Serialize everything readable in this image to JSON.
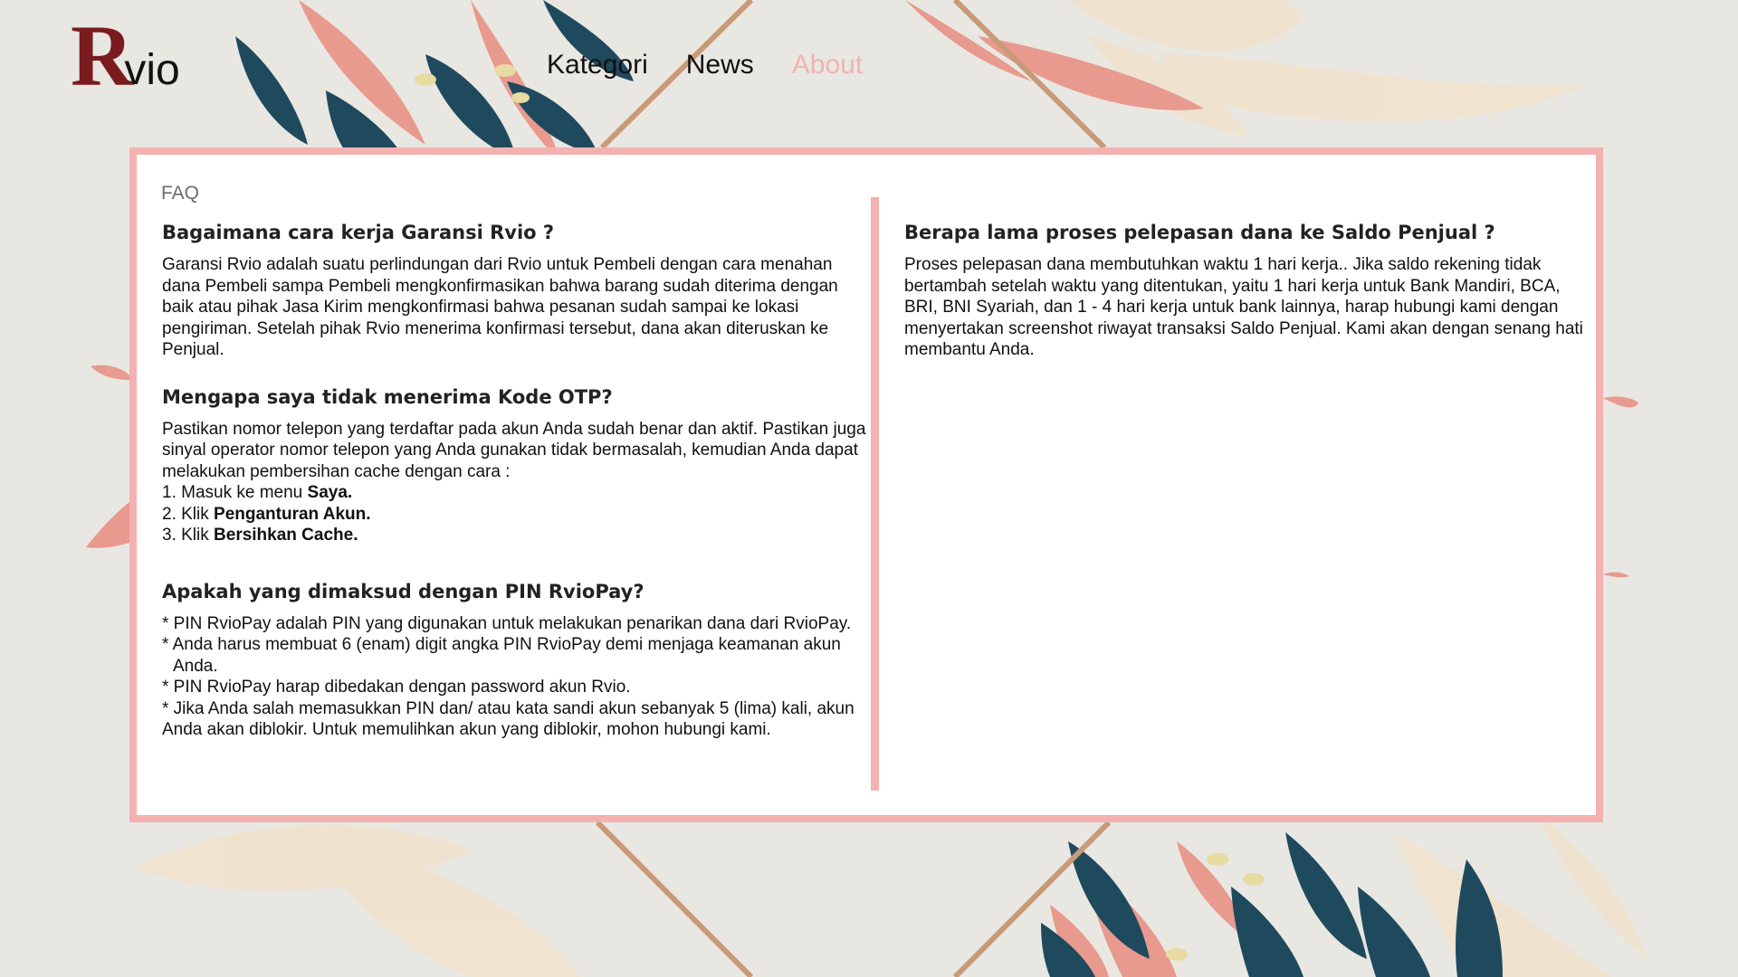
{
  "header": {
    "logo": {
      "first": "R",
      "rest": "vio"
    },
    "nav": [
      {
        "label": "Kategori",
        "active": false
      },
      {
        "label": "News",
        "active": false
      },
      {
        "label": "About",
        "active": true
      }
    ]
  },
  "colors": {
    "accent_pink": "#f3b1b0",
    "logo_red": "#7a1c1f",
    "nav_active": "#f0b4b2",
    "leaf_teal": "#1f4a5e",
    "leaf_pink": "#e89a8f"
  },
  "faq": {
    "label": "FAQ",
    "left": [
      {
        "question": "Bagaimana cara kerja Garansi Rvio ?",
        "answer": "Garansi Rvio adalah suatu perlindungan dari Rvio untuk Pembeli dengan cara menahan dana Pembeli sampa Pembeli mengkonfirmasikan bahwa barang sudah diterima dengan baik atau pihak Jasa Kirim mengkonfirmasi bahwa pesanan sudah sampai ke lokasi pengiriman. Setelah pihak Rvio menerima konfirmasi tersebut, dana akan diteruskan ke Penjual."
      },
      {
        "question": "Mengapa saya tidak menerima Kode OTP?",
        "intro": "Pastikan nomor telepon yang terdaftar pada akun Anda sudah benar dan aktif. Pastikan juga sinyal operator nomor telepon yang Anda gunakan tidak bermasalah, kemudian Anda dapat melakukan pembersihan cache dengan cara :",
        "steps": [
          {
            "prefix": "1. Masuk ke menu ",
            "bold": "Saya."
          },
          {
            "prefix": "2. Klik ",
            "bold": "Penganturan Akun."
          },
          {
            "prefix": "3. Klik ",
            "bold": "Bersihkan Cache."
          }
        ]
      },
      {
        "question": "Apakah yang dimaksud dengan PIN RvioPay?",
        "bullets": [
          "* PIN RvioPay adalah PIN yang digunakan untuk melakukan penarikan dana dari RvioPay.",
          "* Anda harus membuat 6 (enam) digit angka PIN RvioPay demi menjaga keamanan akun Anda.",
          "* PIN RvioPay harap dibedakan dengan password akun Rvio.",
          "* Jika Anda salah memasukkan PIN dan/ atau kata sandi akun sebanyak 5 (lima) kali, akun Anda akan diblokir. Untuk memulihkan akun yang diblokir, mohon hubungi kami."
        ]
      }
    ],
    "right": [
      {
        "question": "Berapa lama proses pelepasan dana ke Saldo Penjual ?",
        "answer": "Proses pelepasan dana membutuhkan waktu 1 hari kerja.. Jika saldo rekening tidak bertambah setelah waktu yang ditentukan, yaitu 1 hari kerja untuk Bank Mandiri, BCA, BRI, BNI Syariah, dan 1 - 4 hari kerja untuk bank lainnya, harap hubungi kami dengan menyertakan screenshot riwayat transaksi Saldo Penjual. Kami akan dengan senang hati membantu Anda."
      }
    ]
  }
}
